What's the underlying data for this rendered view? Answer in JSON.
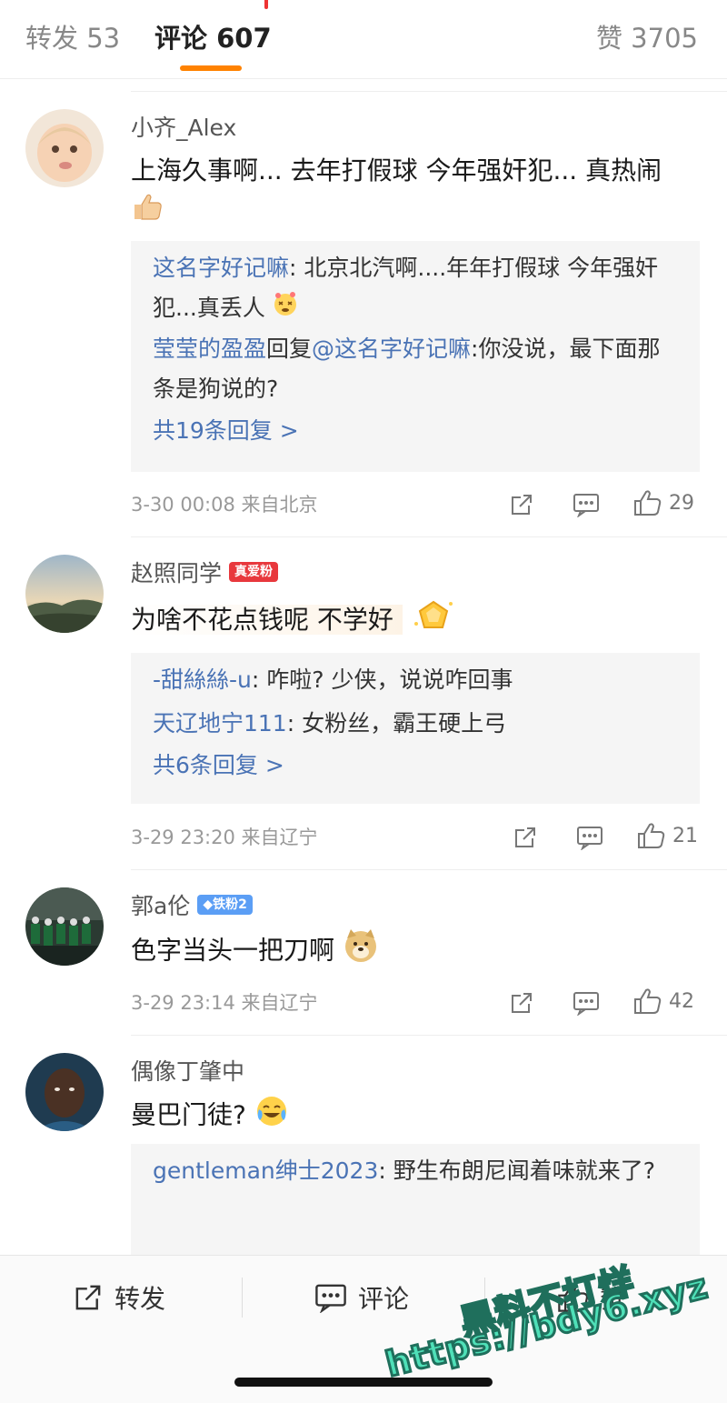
{
  "tabs": {
    "reposts": "转发 53",
    "comments": "评论 607",
    "likes": "赞 3705"
  },
  "comments": [
    {
      "user": "小齐_Alex",
      "text": "上海久事啊... 去年打假球 今年强奸犯... 真热闹",
      "replies": [
        {
          "who": "这名字好记嘛",
          "sep": ": ",
          "text": "北京北汽啊....年年打假球 今年强奸犯...真丢人"
        },
        {
          "who": "莹莹的盈盈",
          "sep": "回复",
          "mention": "@这名字好记嘛",
          "text": ":你没说，最下面那条是狗说的?"
        }
      ],
      "more": "共19条回复 >",
      "time": "3-30 00:08 来自北京",
      "likes": "29"
    },
    {
      "user": "赵照同学",
      "badge": "真爱粉",
      "text": "为啥不花点钱呢  不学好",
      "replies": [
        {
          "who": "-甜絲絲-u",
          "sep": ": ",
          "text": "咋啦? 少侠，说说咋回事"
        },
        {
          "who": "天辽地宁111",
          "sep": ": ",
          "text": "女粉丝，霸王硬上弓"
        }
      ],
      "more": "共6条回复 >",
      "time": "3-29 23:20 来自辽宁",
      "likes": "21"
    },
    {
      "user": "郭a伦",
      "badge": "◆铁粉2",
      "text": "色字当头一把刀啊",
      "time": "3-29 23:14 来自辽宁",
      "likes": "42"
    },
    {
      "user": "偶像丁肇中",
      "text": "曼巴门徒?",
      "replies": [
        {
          "who": "gentleman绅士2023",
          "sep": ": ",
          "text": "野生布朗尼闻着味就来了?"
        }
      ]
    }
  ],
  "bottom_bar": {
    "repost": "转发",
    "comment": "评论",
    "like": "赞"
  },
  "watermark": {
    "line1": "黑料不打烊",
    "line2": "https://bdy6.xyz"
  },
  "icons": [
    "share-icon",
    "comment-icon",
    "like-icon"
  ],
  "colors": {
    "accent": "#ff8200",
    "link": "#4a73b5",
    "watermark": "#4fe0b8"
  }
}
